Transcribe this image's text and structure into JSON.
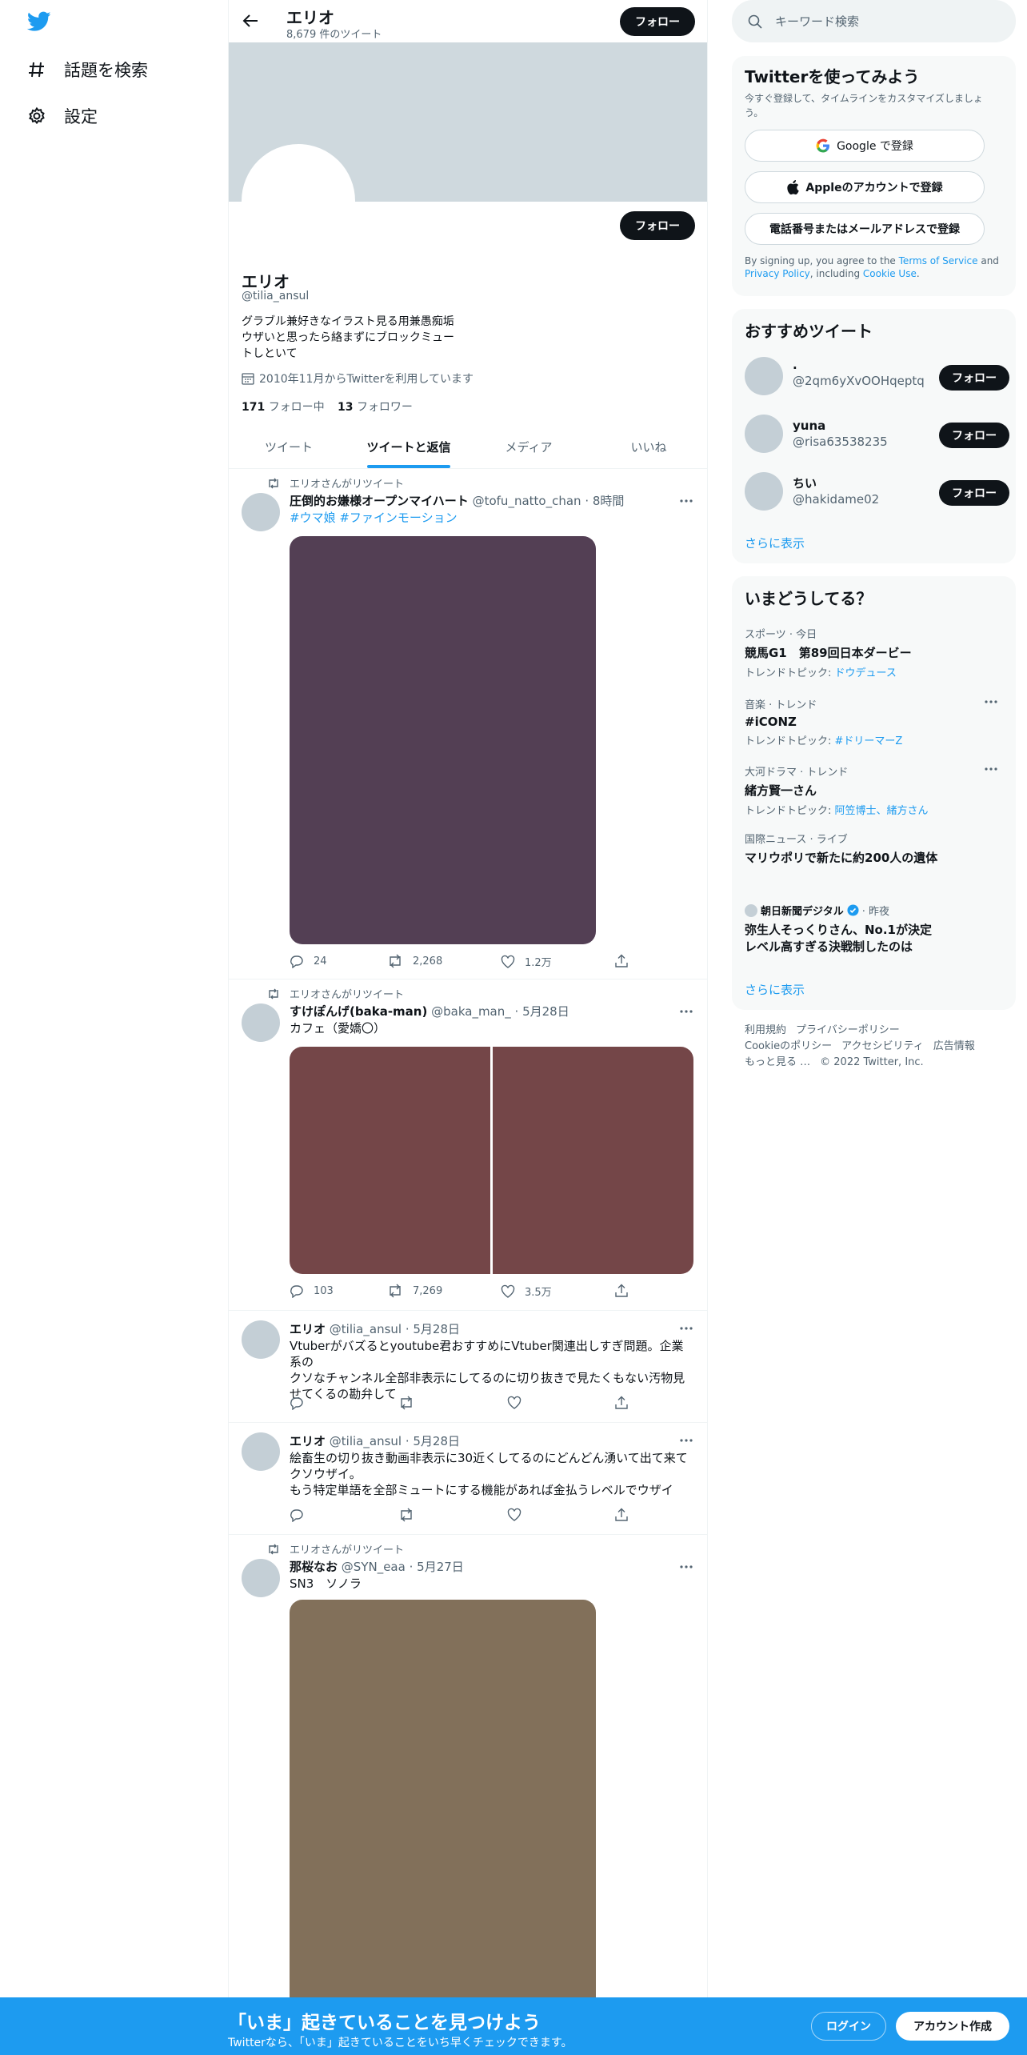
{
  "leftnav": {
    "items": [
      {
        "label": "話題を検索",
        "icon": "hashtag-icon"
      },
      {
        "label": "設定",
        "icon": "gear-icon"
      }
    ]
  },
  "header": {
    "title": "エリオ",
    "subtitle": "8,679 件のツイート",
    "follow_label": "フォロー"
  },
  "profile": {
    "follow_label": "フォロー",
    "name": "エリオ",
    "handle": "@tilia_ansul",
    "bio_line1": "グラブル兼好きなイラスト見る用兼愚痴垢",
    "bio_line2": "ウザいと思ったら絡まずにブロックミュー",
    "bio_line3": "トしといて",
    "joined": "2010年11月からTwitterを利用しています",
    "following_count": "171",
    "following_label": "フォロー中",
    "followers_count": "13",
    "followers_label": "フォロワー"
  },
  "tabs": [
    {
      "label": "ツイート",
      "active": false
    },
    {
      "label": "ツイートと返信",
      "active": true
    },
    {
      "label": "メディア",
      "active": false
    },
    {
      "label": "いいね",
      "active": false
    }
  ],
  "tweets": [
    {
      "retweeted_by": "エリオさんがリツイート",
      "name": "圧倒的お嫌様オープンマイハート",
      "handle": "@tofu_natto_chan",
      "time": "· 8時間",
      "text": "",
      "hashtags": "#ウマ娘 #ファインモーション",
      "reply_count": "24",
      "retweet_count": "2,268",
      "like_count": "1.2万",
      "media_color": "#533f54"
    },
    {
      "retweeted_by": "エリオさんがリツイート",
      "name": "すけぽんげ(baka-man)",
      "handle": "@baka_man_",
      "time": "· 5月28日",
      "text": "カフェ（愛嬌〇）",
      "reply_count": "103",
      "retweet_count": "7,269",
      "like_count": "3.5万",
      "media_color": "#744648"
    },
    {
      "name": "エリオ",
      "handle": "@tilia_ansul",
      "time": "· 5月28日",
      "text_lines": [
        "Vtuberがバズるとyoutube君おすすめにVtuber関連出しすぎ問題。企業系の",
        "クソなチャンネル全部非表示にしてるのに切り抜きで見たくもない汚物見",
        "せてくるの勘弁して"
      ]
    },
    {
      "name": "エリオ",
      "handle": "@tilia_ansul",
      "time": "· 5月28日",
      "text_lines": [
        "絵畜生の切り抜き動画非表示に30近くしてるのにどんどん湧いて出て来て",
        "クソウザイ。",
        "もう特定単語を全部ミュートにする機能があれば金払うレベルでウザイ"
      ]
    },
    {
      "retweeted_by": "エリオさんがリツイート",
      "name": "那桜なお",
      "handle": "@SYN_eaa",
      "time": "· 5月27日",
      "text": "SN3　ソノラ",
      "media_color": "#82705a"
    }
  ],
  "right": {
    "search_placeholder": "キーワード検索",
    "signup": {
      "title": "Twitterを使ってみよう",
      "desc_line1": "今すぐ登録して、タイムラインをカスタマイズしましょ",
      "desc_line2": "う。",
      "google_label": "Google で登録",
      "apple_label": "Appleのアカウントで登録",
      "phone_label": "電話番号またはメールアドレスで登録",
      "legal_prefix": "By signing up, you agree to the ",
      "tos": "Terms of Service",
      "and": " and",
      "privacy": "Privacy Policy",
      "including": ", including ",
      "cookie": "Cookie Use",
      "dot": "."
    },
    "suggestions": {
      "title": "おすすめツイート",
      "follow_label": "フォロー",
      "show_more": "さらに表示",
      "items": [
        {
          "name": ".",
          "handle": "@2qm6yXvOOHqeptq"
        },
        {
          "name": "yuna",
          "handle": "@risa63538235"
        },
        {
          "name": "ちい",
          "handle": "@hakidame02"
        }
      ]
    },
    "trends": {
      "title": "いまどうしてる？",
      "show_more": "さらに表示",
      "items": [
        {
          "meta": "スポーツ · 今日",
          "name": "競馬G1　第89回日本ダービー",
          "topic_prefix": "トレンドトピック: ",
          "topic": "ドウデュース"
        },
        {
          "meta": "音楽 · トレンド",
          "name": "#iCONZ",
          "topic_prefix": "トレンドトピック: ",
          "topic": "#ドリーマーZ"
        },
        {
          "meta": "大河ドラマ · トレンド",
          "name": "緒方賢一さん",
          "topic_prefix": "トレンドトピック: ",
          "topic": "阿笠博士、緒方さん"
        },
        {
          "meta": "国際ニュース · ライブ",
          "name": "マリウポリで新たに約200人の遺体"
        }
      ],
      "news": {
        "source": "朝日新聞デジタル",
        "time": "· 昨夜",
        "line1": "弥生人そっくりさん、No.1が決定",
        "line2": "レベル高すぎる決戦制したのは"
      }
    },
    "footer": {
      "terms": "利用規約",
      "privacy": "プライバシーポリシー",
      "cookie": "Cookieのポリシー",
      "accessibility": "アクセシビリティ",
      "ads": "広告情報",
      "more": "もっと見る …",
      "copyright": "© 2022 Twitter, Inc."
    }
  },
  "bottombar": {
    "headline": "「いま」起きていることを見つけよう",
    "sub": "Twitterなら、「いま」起きていることをいち早くチェックできます。",
    "login": "ログイン",
    "signup": "アカウント作成"
  },
  "colors": {
    "accent": "#1d9bf0",
    "bg_light": "#f7f9f9",
    "text": "#0f1419",
    "muted": "#536471"
  }
}
